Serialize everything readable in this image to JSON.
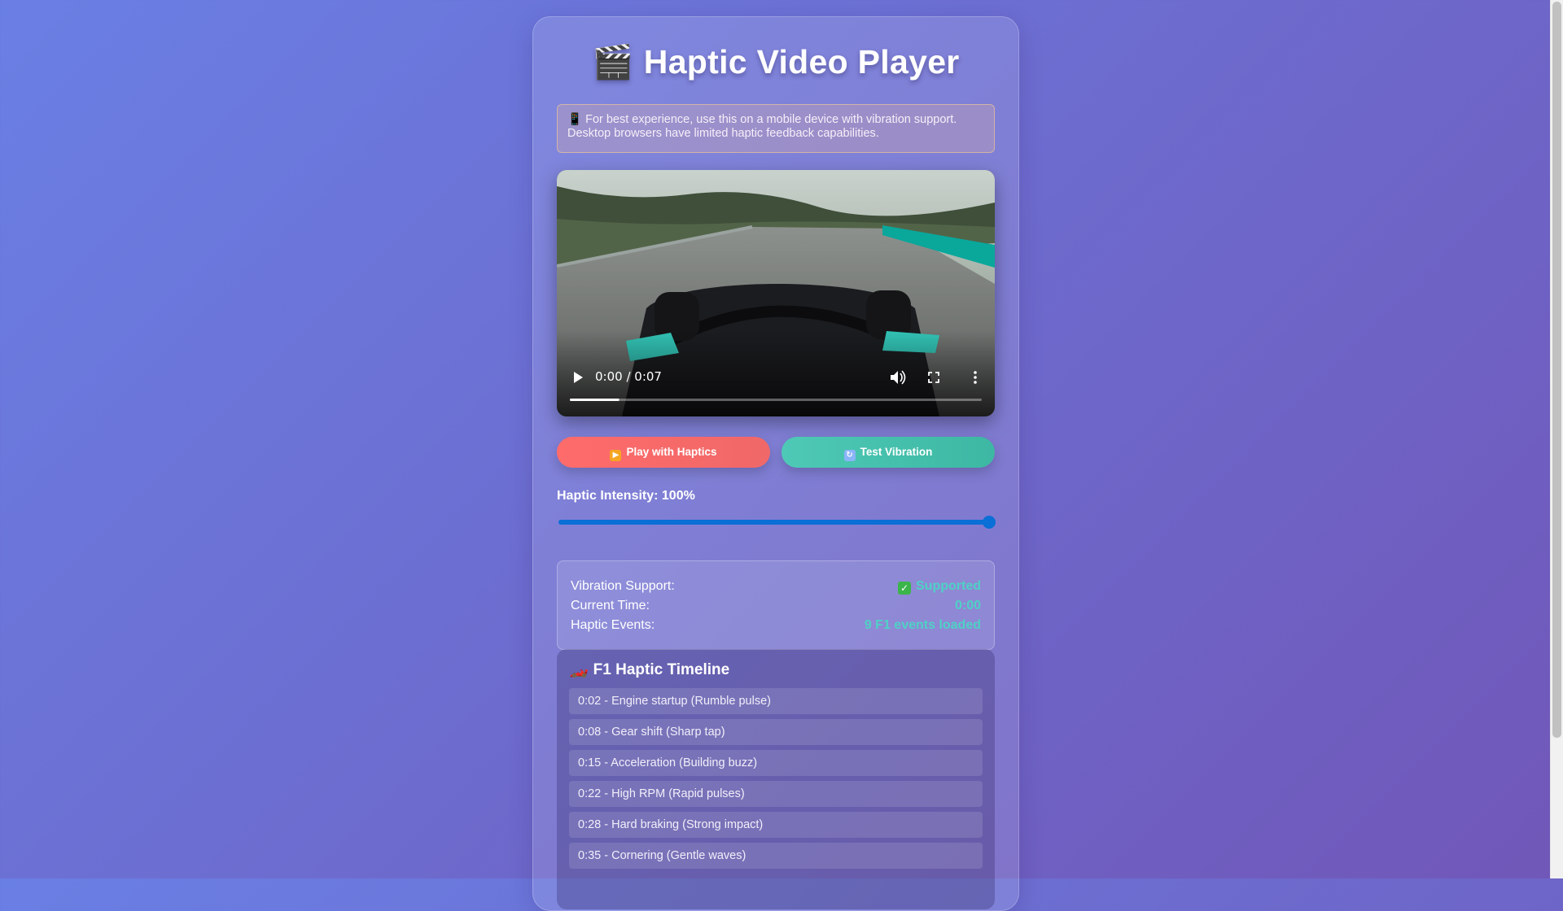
{
  "title": {
    "emoji": "🎬",
    "text": "Haptic Video Player"
  },
  "notice": {
    "emoji": "📱",
    "text": "For best experience, use this on a mobile device with vibration support. Desktop browsers have limited haptic feedback capabilities."
  },
  "video": {
    "time": "0:00 / 0:07",
    "progress": 0.12,
    "icons": [
      "play-icon",
      "volume-icon",
      "fullscreen-icon",
      "more-options-icon"
    ]
  },
  "buttons": {
    "play_label": "Play with Haptics",
    "test_label": "Test Vibration"
  },
  "intensity": {
    "label": "Haptic Intensity: 100%",
    "value": 100
  },
  "status": {
    "vibration_label": "Vibration Support:",
    "vibration_value": "Supported",
    "time_label": "Current Time:",
    "time_value": "0:00",
    "events_label": "Haptic Events:",
    "events_value": "9 F1 events loaded"
  },
  "timeline": {
    "title": "F1 Haptic Timeline",
    "events": [
      "0:02 - Engine startup (Rumble pulse)",
      "0:08 - Gear shift (Sharp tap)",
      "0:15 - Acceleration (Building buzz)",
      "0:22 - High RPM (Rapid pulses)",
      "0:28 - Hard braking (Strong impact)",
      "0:35 - Cornering (Gentle waves)"
    ]
  },
  "colors": {
    "accent_teal": "#4ed1c5",
    "play_red": "#ff6b6b",
    "test_teal": "#3db8a3",
    "slider_blue": "#0a6fd6"
  }
}
